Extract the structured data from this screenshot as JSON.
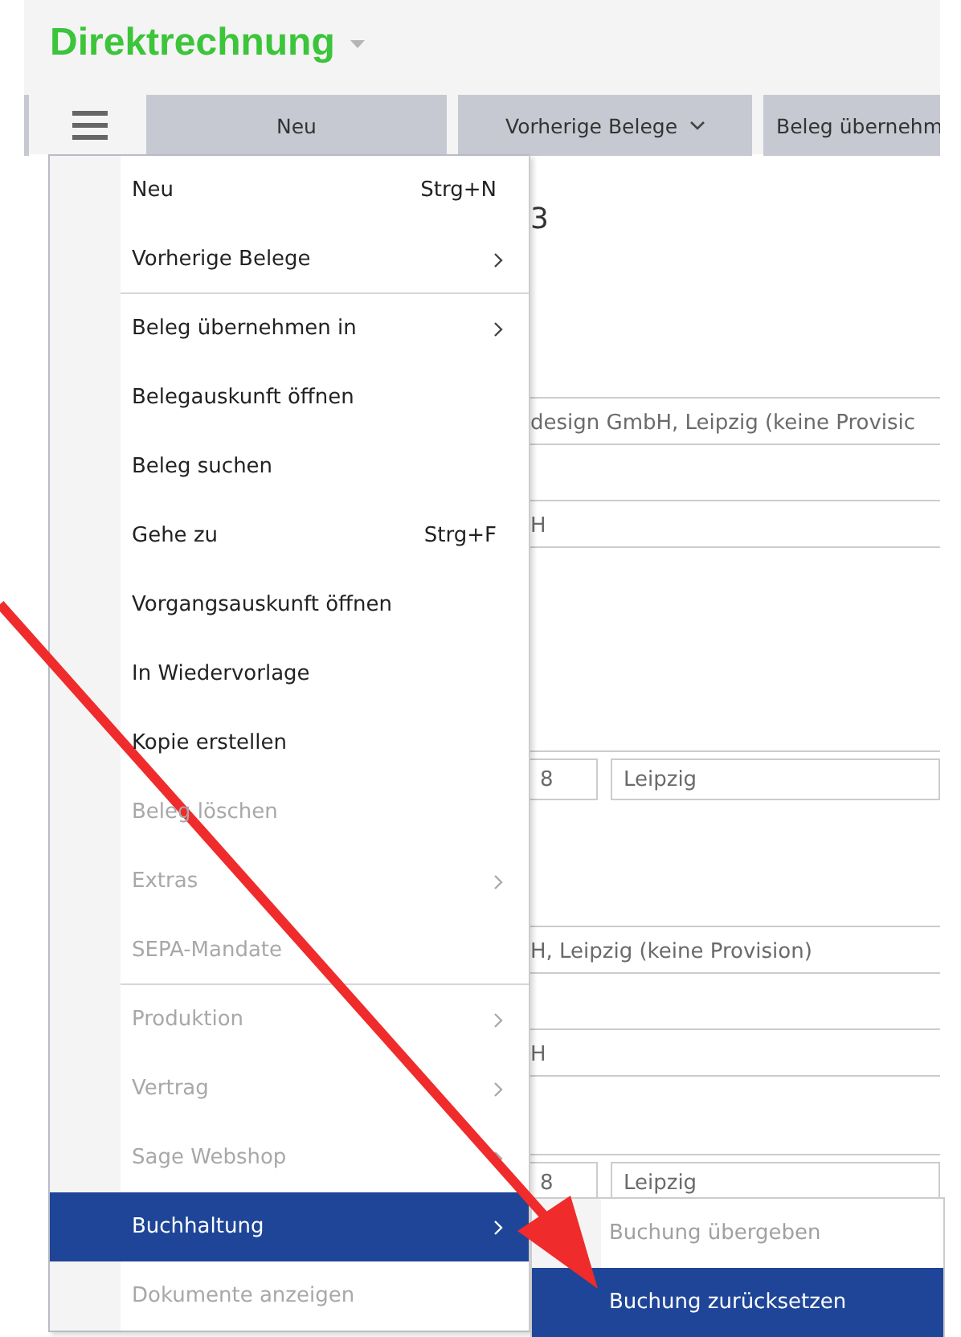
{
  "header": {
    "title": "Direktrechnung"
  },
  "toolbar": {
    "buttons": [
      {
        "label": "Neu",
        "kind": "plain"
      },
      {
        "label": "Vorherige Belege",
        "kind": "dropdown"
      },
      {
        "label": "Beleg übernehm",
        "kind": "plain"
      }
    ]
  },
  "form": {
    "fields": [
      {
        "kind": "heading",
        "value": "3"
      },
      {
        "kind": "line",
        "value": "design GmbH, Leipzig  (keine Provisic"
      },
      {
        "kind": "line",
        "value": "H"
      },
      {
        "kind": "pair",
        "value": "8",
        "value2": "Leipzig"
      },
      {
        "kind": "line",
        "value": "H, Leipzig (keine Provision)"
      },
      {
        "kind": "line",
        "value": "H"
      },
      {
        "kind": "pair",
        "value": "8",
        "value2": "Leipzig"
      }
    ]
  },
  "menu": {
    "items": [
      {
        "label": "Neu",
        "shortcut": "Strg+N",
        "submenu": false,
        "disabled": false,
        "selected": false,
        "separator_after": false
      },
      {
        "label": "Vorherige Belege",
        "submenu": true,
        "disabled": false,
        "selected": false,
        "separator_after": true
      },
      {
        "label": "Beleg übernehmen in",
        "submenu": true,
        "disabled": false,
        "selected": false,
        "separator_after": false
      },
      {
        "label": "Belegauskunft öffnen",
        "submenu": false,
        "disabled": false,
        "selected": false,
        "separator_after": false
      },
      {
        "label": "Beleg suchen",
        "submenu": false,
        "disabled": false,
        "selected": false,
        "separator_after": false
      },
      {
        "label": "Gehe zu",
        "shortcut": "Strg+F",
        "submenu": false,
        "disabled": false,
        "selected": false,
        "separator_after": false
      },
      {
        "label": "Vorgangsauskunft öffnen",
        "submenu": false,
        "disabled": false,
        "selected": false,
        "separator_after": false
      },
      {
        "label": "In Wiedervorlage",
        "submenu": false,
        "disabled": false,
        "selected": false,
        "separator_after": false
      },
      {
        "label": "Kopie erstellen",
        "submenu": false,
        "disabled": false,
        "selected": false,
        "separator_after": false
      },
      {
        "label": "Beleg löschen",
        "submenu": false,
        "disabled": true,
        "selected": false,
        "separator_after": false
      },
      {
        "label": "Extras",
        "submenu": true,
        "disabled": true,
        "selected": false,
        "separator_after": false
      },
      {
        "label": "SEPA-Mandate",
        "submenu": false,
        "disabled": true,
        "selected": false,
        "separator_after": true
      },
      {
        "label": "Produktion",
        "submenu": true,
        "disabled": true,
        "selected": false,
        "separator_after": false
      },
      {
        "label": "Vertrag",
        "submenu": true,
        "disabled": true,
        "selected": false,
        "separator_after": false
      },
      {
        "label": "Sage Webshop",
        "submenu": true,
        "disabled": true,
        "selected": false,
        "separator_after": false
      },
      {
        "label": "Buchhaltung",
        "submenu": true,
        "disabled": false,
        "selected": true,
        "separator_after": false
      },
      {
        "label": "Dokumente anzeigen",
        "submenu": false,
        "disabled": true,
        "selected": false,
        "separator_after": false
      }
    ]
  },
  "submenu": {
    "items": [
      {
        "label": "Buchung übergeben",
        "disabled": true,
        "selected": false
      },
      {
        "label": "Buchung zurücksetzen",
        "disabled": false,
        "selected": true
      }
    ]
  }
}
